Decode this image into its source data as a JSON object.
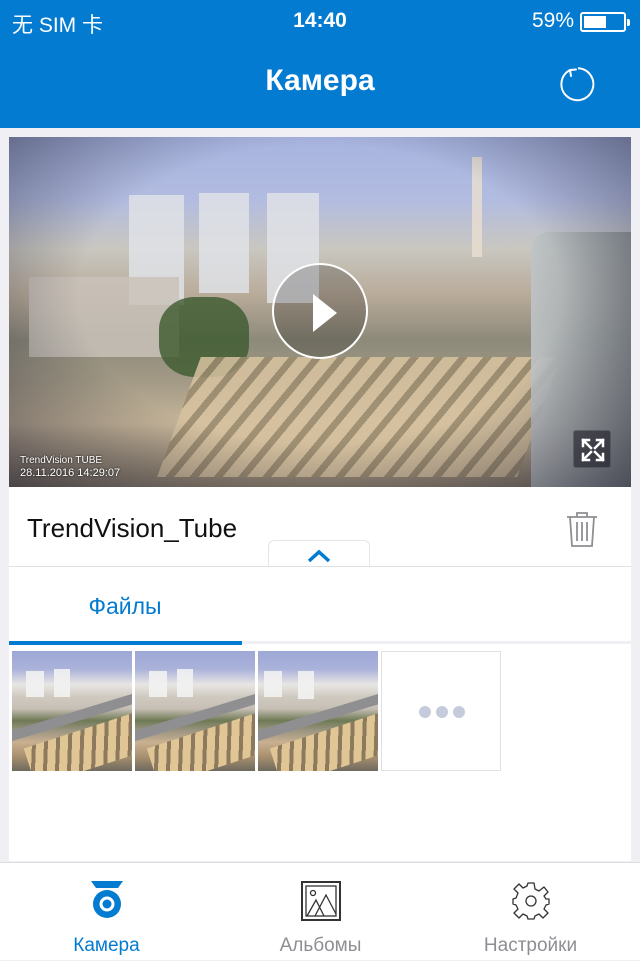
{
  "status_bar": {
    "carrier": "无 SIM 卡",
    "time": "14:40",
    "battery_percent": "59%",
    "battery_level": 0.59
  },
  "header": {
    "title": "Камера",
    "refresh_icon": "refresh-icon"
  },
  "camera": {
    "name": "TrendVision_Tube",
    "overlay_device": "TrendVision TUBE",
    "overlay_timestamp": "28.11.2016  14:29:07",
    "play_icon": "play-icon",
    "fullscreen_icon": "expand-arrows-icon",
    "delete_icon": "trash-icon",
    "collapse_icon": "chevron-up-icon"
  },
  "tabs": [
    {
      "label": "Файлы",
      "active": true
    }
  ],
  "files": {
    "thumbnails": [
      {
        "type": "photo"
      },
      {
        "type": "photo"
      },
      {
        "type": "photo"
      }
    ],
    "more_icon": "ellipsis-icon"
  },
  "tabbar": {
    "items": [
      {
        "label": "Камера",
        "icon": "camera-icon",
        "active": true
      },
      {
        "label": "Альбомы",
        "icon": "picture-icon",
        "active": false
      },
      {
        "label": "Настройки",
        "icon": "gear-icon",
        "active": false
      }
    ]
  },
  "colors": {
    "accent": "#037bd0",
    "inactive": "#8e8e93",
    "background": "#efeff4"
  }
}
